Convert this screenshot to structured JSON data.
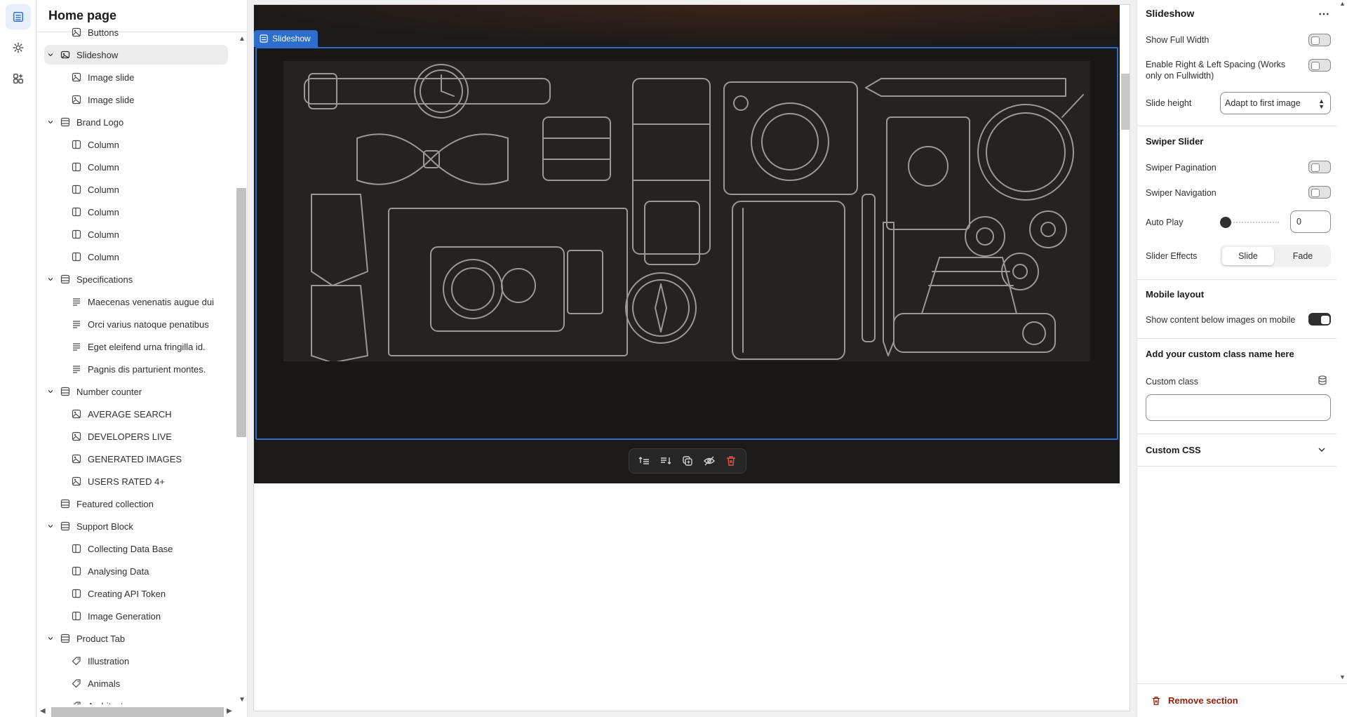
{
  "rail": {
    "items": [
      {
        "icon": "sections-icon",
        "active": true
      },
      {
        "icon": "gear-icon",
        "active": false
      },
      {
        "icon": "apps-icon",
        "active": false
      }
    ]
  },
  "sidebar": {
    "title": "Home page",
    "tree": [
      {
        "label": "Buttons",
        "kind": "block",
        "level": 1,
        "icon": "image-block-icon"
      },
      {
        "label": "Slideshow",
        "kind": "section",
        "level": 0,
        "icon": "slideshow-icon",
        "expanded": true,
        "selected": true
      },
      {
        "label": "Image slide",
        "kind": "block",
        "level": 1,
        "icon": "image-block-icon"
      },
      {
        "label": "Image slide",
        "kind": "block",
        "level": 1,
        "icon": "image-block-icon"
      },
      {
        "label": "Brand Logo",
        "kind": "section",
        "level": 0,
        "icon": "section-icon",
        "expanded": true
      },
      {
        "label": "Column",
        "kind": "block",
        "level": 1,
        "icon": "column-icon"
      },
      {
        "label": "Column",
        "kind": "block",
        "level": 1,
        "icon": "column-icon"
      },
      {
        "label": "Column",
        "kind": "block",
        "level": 1,
        "icon": "column-icon"
      },
      {
        "label": "Column",
        "kind": "block",
        "level": 1,
        "icon": "column-icon"
      },
      {
        "label": "Column",
        "kind": "block",
        "level": 1,
        "icon": "column-icon"
      },
      {
        "label": "Column",
        "kind": "block",
        "level": 1,
        "icon": "column-icon"
      },
      {
        "label": "Specifications",
        "kind": "section",
        "level": 0,
        "icon": "section-icon",
        "expanded": true
      },
      {
        "label": "Maecenas venenatis augue dui",
        "kind": "block",
        "level": 1,
        "icon": "text-lines-icon"
      },
      {
        "label": "Orci varius natoque penatibus",
        "kind": "block",
        "level": 1,
        "icon": "text-lines-icon"
      },
      {
        "label": "Eget eleifend urna fringilla id.",
        "kind": "block",
        "level": 1,
        "icon": "text-lines-icon"
      },
      {
        "label": "Pagnis dis parturient montes.",
        "kind": "block",
        "level": 1,
        "icon": "text-lines-icon"
      },
      {
        "label": "Number counter",
        "kind": "section",
        "level": 0,
        "icon": "section-icon",
        "expanded": true
      },
      {
        "label": "AVERAGE SEARCH",
        "kind": "block",
        "level": 1,
        "icon": "image-block-icon"
      },
      {
        "label": "DEVELOPERS LIVE",
        "kind": "block",
        "level": 1,
        "icon": "image-block-icon"
      },
      {
        "label": "GENERATED IMAGES",
        "kind": "block",
        "level": 1,
        "icon": "image-block-icon"
      },
      {
        "label": "USERS RATED 4+",
        "kind": "block",
        "level": 1,
        "icon": "image-block-icon"
      },
      {
        "label": "Featured collection",
        "kind": "section",
        "level": 0,
        "icon": "section-icon",
        "expanded": false,
        "nochevron": true
      },
      {
        "label": "Support Block",
        "kind": "section",
        "level": 0,
        "icon": "section-icon",
        "expanded": true
      },
      {
        "label": "Collecting Data Base",
        "kind": "block",
        "level": 1,
        "icon": "column-icon"
      },
      {
        "label": "Analysing Data",
        "kind": "block",
        "level": 1,
        "icon": "column-icon"
      },
      {
        "label": "Creating API Token",
        "kind": "block",
        "level": 1,
        "icon": "column-icon"
      },
      {
        "label": "Image Generation",
        "kind": "block",
        "level": 1,
        "icon": "column-icon"
      },
      {
        "label": "Product Tab",
        "kind": "section",
        "level": 0,
        "icon": "section-icon",
        "expanded": true
      },
      {
        "label": "Illustration",
        "kind": "block",
        "level": 1,
        "icon": "tag-icon"
      },
      {
        "label": "Animals",
        "kind": "block",
        "level": 1,
        "icon": "tag-icon"
      },
      {
        "label": "Architecture",
        "kind": "block",
        "level": 1,
        "icon": "tag-icon"
      }
    ]
  },
  "canvas": {
    "section_tag": "Slideshow",
    "toolbar": [
      {
        "icon": "move-up-icon"
      },
      {
        "icon": "move-down-icon"
      },
      {
        "icon": "duplicate-icon"
      },
      {
        "icon": "hide-icon"
      },
      {
        "icon": "delete-icon"
      }
    ]
  },
  "settings": {
    "title": "Slideshow",
    "show_full_width": {
      "label": "Show Full Width",
      "on": false
    },
    "lr_spacing": {
      "label": "Enable Right & Left Spacing (Works only on Fullwidth)",
      "on": false
    },
    "slide_height": {
      "label": "Slide height",
      "value": "Adapt to first image"
    },
    "swiper_heading": "Swiper Slider",
    "swiper_pagination": {
      "label": "Swiper Pagination",
      "on": false
    },
    "swiper_navigation": {
      "label": "Swiper Navigation",
      "on": false
    },
    "auto_play": {
      "label": "Auto Play",
      "value": "0"
    },
    "slider_effects": {
      "label": "Slider Effects",
      "options": [
        "Slide",
        "Fade"
      ],
      "selected": "Slide"
    },
    "mobile_heading": "Mobile layout",
    "mobile_content_below": {
      "label": "Show content below images on mobile",
      "on": true
    },
    "custom_class_heading": "Add your custom class name here",
    "custom_class": {
      "label": "Custom class",
      "value": ""
    },
    "custom_css": {
      "label": "Custom CSS"
    },
    "remove": {
      "label": "Remove section"
    }
  },
  "colors": {
    "accent": "#2c6ecb",
    "danger": "#8e1f0b",
    "canvas_dark": "#1c1a19"
  }
}
